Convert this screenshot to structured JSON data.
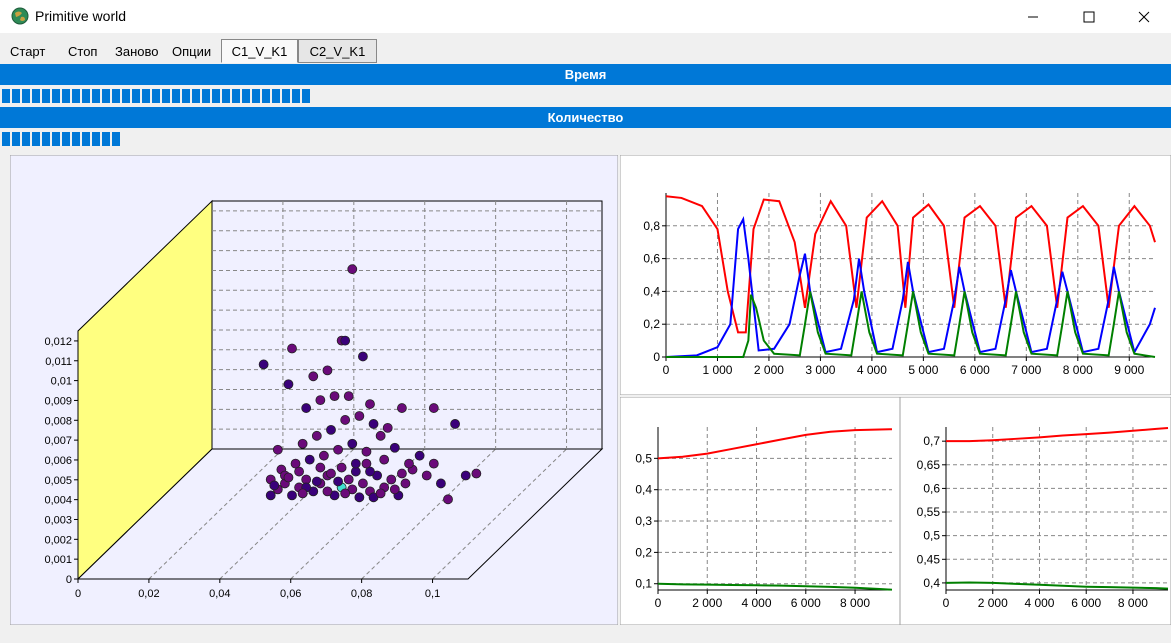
{
  "window": {
    "title": "Primitive world"
  },
  "menu": {
    "items": [
      "Старт",
      "Стоп",
      "Заново",
      "Опции"
    ]
  },
  "tabs": [
    {
      "label": "C1_V_K1",
      "active": true
    },
    {
      "label": "C2_V_K1",
      "active": false
    }
  ],
  "bars": {
    "time_label": "Время",
    "count_label": "Количество",
    "time_progress_blocks": 31,
    "count_progress_blocks": 12
  },
  "colors": {
    "accent": "#0078d7",
    "series_red": "#ff0000",
    "series_blue": "#0000ff",
    "series_green": "#008000",
    "wall": "#ffff80",
    "point": "#4b0082"
  },
  "chart_data": [
    {
      "type": "scatter",
      "view": "3d",
      "x_ticks": [
        "0",
        "0,02",
        "0,04",
        "0,06",
        "0,08",
        "0,1"
      ],
      "y_ticks": [
        "0",
        "0,001",
        "0,002",
        "0,003",
        "0,004",
        "0,005",
        "0,006",
        "0,007",
        "0,008",
        "0,009",
        "0,01",
        "0,011",
        "0,012"
      ],
      "xlim": [
        0,
        0.11
      ],
      "ylim": [
        0,
        0.012
      ],
      "points": [
        [
          0.06,
          0.0022
        ],
        [
          0.062,
          0.0025
        ],
        [
          0.064,
          0.0028
        ],
        [
          0.066,
          0.0022
        ],
        [
          0.068,
          0.0026
        ],
        [
          0.07,
          0.003
        ],
        [
          0.072,
          0.0024
        ],
        [
          0.074,
          0.0028
        ],
        [
          0.076,
          0.0032
        ],
        [
          0.078,
          0.0022
        ],
        [
          0.08,
          0.0026
        ],
        [
          0.082,
          0.003
        ],
        [
          0.084,
          0.0034
        ],
        [
          0.086,
          0.0028
        ],
        [
          0.088,
          0.0024
        ],
        [
          0.09,
          0.0032
        ],
        [
          0.092,
          0.0026
        ],
        [
          0.094,
          0.003
        ],
        [
          0.096,
          0.0022
        ],
        [
          0.098,
          0.0028
        ],
        [
          0.1,
          0.0035
        ],
        [
          0.102,
          0.0042
        ],
        [
          0.104,
          0.0032
        ],
        [
          0.106,
          0.0038
        ],
        [
          0.108,
          0.0028
        ],
        [
          0.063,
          0.0035
        ],
        [
          0.067,
          0.0038
        ],
        [
          0.071,
          0.004
        ],
        [
          0.075,
          0.0042
        ],
        [
          0.079,
          0.0045
        ],
        [
          0.083,
          0.0048
        ],
        [
          0.087,
          0.0044
        ],
        [
          0.091,
          0.0052
        ],
        [
          0.095,
          0.0046
        ],
        [
          0.069,
          0.0048
        ],
        [
          0.073,
          0.0052
        ],
        [
          0.077,
          0.0055
        ],
        [
          0.081,
          0.006
        ],
        [
          0.085,
          0.0062
        ],
        [
          0.089,
          0.0058
        ],
        [
          0.093,
          0.0056
        ],
        [
          0.097,
          0.0066
        ],
        [
          0.07,
          0.0066
        ],
        [
          0.074,
          0.007
        ],
        [
          0.078,
          0.0072
        ],
        [
          0.065,
          0.0078
        ],
        [
          0.082,
          0.0072
        ],
        [
          0.088,
          0.0068
        ],
        [
          0.058,
          0.0088
        ],
        [
          0.072,
          0.0082
        ],
        [
          0.076,
          0.0085
        ],
        [
          0.086,
          0.0092
        ],
        [
          0.066,
          0.0096
        ],
        [
          0.08,
          0.01
        ],
        [
          0.081,
          0.01
        ],
        [
          0.083,
          0.0136
        ],
        [
          0.106,
          0.0066
        ],
        [
          0.112,
          0.0058
        ],
        [
          0.062,
          0.0045
        ],
        [
          0.064,
          0.0032
        ],
        [
          0.07,
          0.0026
        ],
        [
          0.076,
          0.0024
        ],
        [
          0.08,
          0.0036
        ],
        [
          0.088,
          0.0034
        ],
        [
          0.092,
          0.004
        ],
        [
          0.068,
          0.0034
        ],
        [
          0.084,
          0.0038
        ],
        [
          0.06,
          0.003
        ],
        [
          0.074,
          0.0036
        ],
        [
          0.079,
          0.0029
        ],
        [
          0.083,
          0.0025
        ],
        [
          0.087,
          0.0038
        ],
        [
          0.089,
          0.0021
        ],
        [
          0.095,
          0.0025
        ],
        [
          0.099,
          0.0038
        ],
        [
          0.061,
          0.0027
        ],
        [
          0.065,
          0.0031
        ],
        [
          0.069,
          0.0023
        ],
        [
          0.073,
          0.0029
        ],
        [
          0.077,
          0.0033
        ],
        [
          0.081,
          0.0023
        ],
        [
          0.085,
          0.0021
        ],
        [
          0.091,
          0.0023
        ],
        [
          0.097,
          0.0033
        ],
        [
          0.115,
          0.0032
        ],
        [
          0.118,
          0.0033
        ],
        [
          0.11,
          0.002
        ]
      ]
    },
    {
      "type": "line",
      "x_ticks": [
        "0",
        "1 000",
        "2 000",
        "3 000",
        "4 000",
        "5 000",
        "6 000",
        "7 000",
        "8 000",
        "9 000"
      ],
      "y_ticks": [
        "0",
        "0,2",
        "0,4",
        "0,6",
        "0,8"
      ],
      "xlim": [
        0,
        9500
      ],
      "ylim": [
        0,
        1
      ],
      "series": [
        {
          "color": "#ff0000",
          "x": [
            0,
            300,
            700,
            1000,
            1200,
            1400,
            1550,
            1700,
            1900,
            2200,
            2500,
            2700,
            2900,
            3200,
            3500,
            3700,
            3900,
            4200,
            4500,
            4650,
            4800,
            5100,
            5400,
            5600,
            5800,
            6100,
            6400,
            6600,
            6800,
            7100,
            7400,
            7600,
            7800,
            8100,
            8400,
            8600,
            8800,
            9100,
            9400,
            9500
          ],
          "values": [
            0.98,
            0.97,
            0.92,
            0.78,
            0.4,
            0.15,
            0.15,
            0.78,
            0.96,
            0.95,
            0.7,
            0.3,
            0.75,
            0.95,
            0.8,
            0.3,
            0.85,
            0.95,
            0.8,
            0.3,
            0.85,
            0.93,
            0.8,
            0.3,
            0.85,
            0.92,
            0.8,
            0.3,
            0.85,
            0.92,
            0.8,
            0.3,
            0.85,
            0.92,
            0.8,
            0.3,
            0.8,
            0.92,
            0.8,
            0.7
          ]
        },
        {
          "color": "#0000ff",
          "x": [
            0,
            600,
            1000,
            1250,
            1400,
            1500,
            1600,
            1800,
            2100,
            2400,
            2600,
            2700,
            2800,
            3100,
            3400,
            3650,
            3750,
            3850,
            4100,
            4400,
            4600,
            4700,
            4800,
            5100,
            5400,
            5600,
            5700,
            5800,
            6100,
            6400,
            6600,
            6700,
            6800,
            7100,
            7400,
            7600,
            7700,
            7800,
            8100,
            8400,
            8600,
            8700,
            8800,
            9100,
            9400,
            9500
          ],
          "values": [
            0,
            0.01,
            0.06,
            0.2,
            0.78,
            0.84,
            0.6,
            0.04,
            0.05,
            0.2,
            0.5,
            0.63,
            0.4,
            0.03,
            0.05,
            0.35,
            0.6,
            0.4,
            0.03,
            0.05,
            0.35,
            0.58,
            0.4,
            0.03,
            0.05,
            0.35,
            0.55,
            0.4,
            0.03,
            0.05,
            0.35,
            0.53,
            0.4,
            0.03,
            0.05,
            0.35,
            0.52,
            0.4,
            0.03,
            0.05,
            0.35,
            0.55,
            0.4,
            0.03,
            0.2,
            0.3
          ]
        },
        {
          "color": "#008000",
          "x": [
            0,
            1500,
            1600,
            1650,
            1750,
            1900,
            2100,
            2600,
            2700,
            2800,
            2950,
            3100,
            3600,
            3700,
            3800,
            3950,
            4100,
            4600,
            4700,
            4800,
            4950,
            5100,
            5600,
            5700,
            5800,
            5950,
            6100,
            6600,
            6700,
            6800,
            6950,
            7100,
            7600,
            7700,
            7800,
            7950,
            8100,
            8600,
            8700,
            8800,
            8950,
            9100,
            9500
          ],
          "values": [
            0,
            0.0,
            0.1,
            0.38,
            0.3,
            0.1,
            0.02,
            0.01,
            0.2,
            0.4,
            0.15,
            0.02,
            0.01,
            0.2,
            0.4,
            0.15,
            0.02,
            0.01,
            0.2,
            0.4,
            0.15,
            0.02,
            0.01,
            0.2,
            0.4,
            0.15,
            0.02,
            0.01,
            0.2,
            0.4,
            0.15,
            0.02,
            0.01,
            0.2,
            0.4,
            0.15,
            0.02,
            0.01,
            0.2,
            0.4,
            0.15,
            0.02,
            0
          ]
        }
      ]
    },
    {
      "type": "line",
      "x_ticks": [
        "0",
        "2 000",
        "4 000",
        "6 000",
        "8 000"
      ],
      "y_ticks": [
        "0,1",
        "0,2",
        "0,3",
        "0,4",
        "0,5"
      ],
      "xlim": [
        0,
        9500
      ],
      "ylim": [
        0.08,
        0.6
      ],
      "series": [
        {
          "color": "#ff0000",
          "x": [
            0,
            1000,
            2000,
            3000,
            4000,
            5000,
            6000,
            7000,
            8000,
            9000,
            9500
          ],
          "values": [
            0.5,
            0.505,
            0.515,
            0.53,
            0.545,
            0.56,
            0.575,
            0.585,
            0.59,
            0.592,
            0.593
          ]
        },
        {
          "color": "#008000",
          "x": [
            0,
            1000,
            2000,
            3000,
            4000,
            5000,
            6000,
            7000,
            8000,
            9000,
            9500
          ],
          "values": [
            0.1,
            0.098,
            0.097,
            0.096,
            0.095,
            0.094,
            0.092,
            0.09,
            0.087,
            0.083,
            0.081
          ]
        }
      ]
    },
    {
      "type": "line",
      "x_ticks": [
        "0",
        "2 000",
        "4 000",
        "6 000",
        "8 000"
      ],
      "y_ticks": [
        "0,4",
        "0,45",
        "0,5",
        "0,55",
        "0,6",
        "0,65",
        "0,7"
      ],
      "xlim": [
        0,
        9500
      ],
      "ylim": [
        0.385,
        0.73
      ],
      "series": [
        {
          "color": "#ff0000",
          "x": [
            0,
            1000,
            2000,
            3000,
            4000,
            5000,
            6000,
            7000,
            8000,
            9000,
            9500
          ],
          "values": [
            0.7,
            0.7,
            0.702,
            0.705,
            0.708,
            0.712,
            0.715,
            0.718,
            0.722,
            0.726,
            0.728
          ]
        },
        {
          "color": "#008000",
          "x": [
            0,
            1000,
            2000,
            3000,
            4000,
            5000,
            6000,
            7000,
            8000,
            9000,
            9500
          ],
          "values": [
            0.4,
            0.401,
            0.4,
            0.398,
            0.396,
            0.394,
            0.392,
            0.391,
            0.39,
            0.389,
            0.388
          ]
        }
      ]
    }
  ]
}
